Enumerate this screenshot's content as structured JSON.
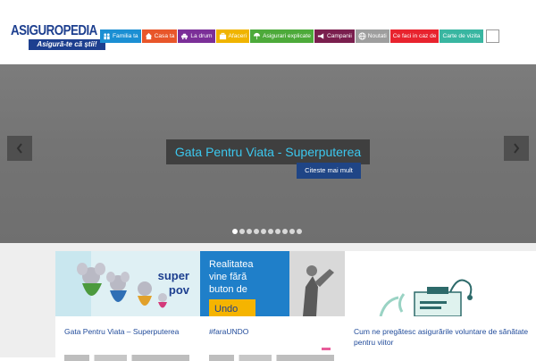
{
  "logo": {
    "name": "ASIGUROPEDIA",
    "tagline": "Asigură-te că știi!"
  },
  "nav": {
    "items": [
      {
        "label": "Familia ta",
        "icon": "family-icon",
        "color": "#1b8fd3"
      },
      {
        "label": "Casa ta",
        "icon": "house-icon",
        "color": "#e8562a"
      },
      {
        "label": "La drum",
        "icon": "car-icon",
        "color": "#7b2f98"
      },
      {
        "label": "Afaceri",
        "icon": "briefcase-icon",
        "color": "#f0b400"
      },
      {
        "label": "Asigurari explicate",
        "icon": "umbrella-icon",
        "color": "#4daa3a"
      },
      {
        "label": "Campanii",
        "icon": "megaphone-icon",
        "color": "#7a1f4e"
      },
      {
        "label": "Noutati",
        "icon": "globe-icon",
        "color": "#9e9e9e"
      },
      {
        "label": "Ce faci in caz de",
        "icon": "",
        "color": "#e8232e"
      },
      {
        "label": "Carte de vizita",
        "icon": "",
        "color": "#39b6a1"
      }
    ]
  },
  "hero": {
    "title": "Gata Pentru Viata - Superputerea",
    "more_label": "Citeste mai mult",
    "dots": 10,
    "active_dot": 0
  },
  "cards": [
    {
      "title": "Gata Pentru Viata – Superputerea",
      "img_text": [
        "super",
        "pov"
      ]
    },
    {
      "title": "#faraUNDO",
      "img_text": [
        "Realitatea",
        "vine fără",
        "buton de",
        "Undo"
      ]
    },
    {
      "title": "Cum ne pregătesc asigurările voluntare de sănătate pentru viitor"
    }
  ]
}
